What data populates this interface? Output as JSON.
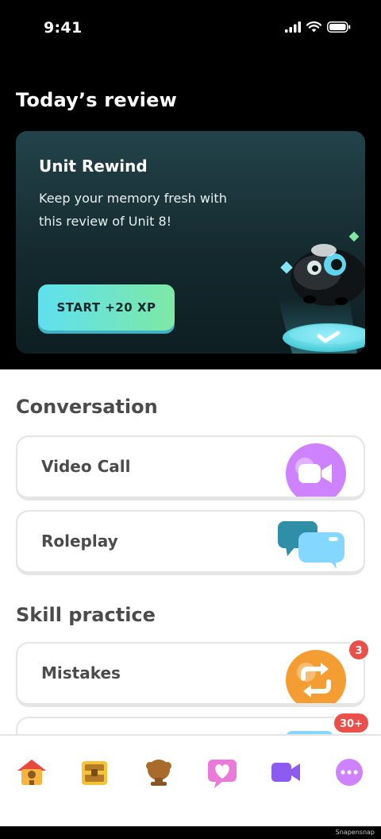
{
  "status_bar": {
    "time": "9:41"
  },
  "review": {
    "heading": "Today’s review",
    "card": {
      "title": "Unit Rewind",
      "description": "Keep your memory fresh with this review of Unit 8!",
      "start_label": "START +20 XP"
    }
  },
  "conversation": {
    "heading": "Conversation",
    "items": [
      {
        "label": "Video Call",
        "icon": "video-camera-icon",
        "color": "#ce82ff"
      },
      {
        "label": "Roleplay",
        "icon": "chat-bubbles-icon",
        "color": "#84d8ff"
      }
    ]
  },
  "skill_practice": {
    "heading": "Skill practice",
    "items": [
      {
        "label": "Mistakes",
        "icon": "refresh-arrows-icon",
        "color": "#f49d33",
        "badge": "3"
      },
      {
        "label": "",
        "icon": "partial-icon",
        "badge": "30+"
      }
    ]
  },
  "bottom_nav": {
    "items": [
      {
        "icon": "home-icon"
      },
      {
        "icon": "treasure-chest-icon"
      },
      {
        "icon": "trophy-icon"
      },
      {
        "icon": "heart-icon"
      },
      {
        "icon": "video-icon"
      },
      {
        "icon": "more-icon"
      }
    ]
  },
  "watermark": "Snapensnap",
  "colors": {
    "accent_teal": "#5fe0ef",
    "accent_green": "#7ee8a5",
    "badge_red": "#ea4f4a",
    "text_dark": "#4b4b4b"
  }
}
